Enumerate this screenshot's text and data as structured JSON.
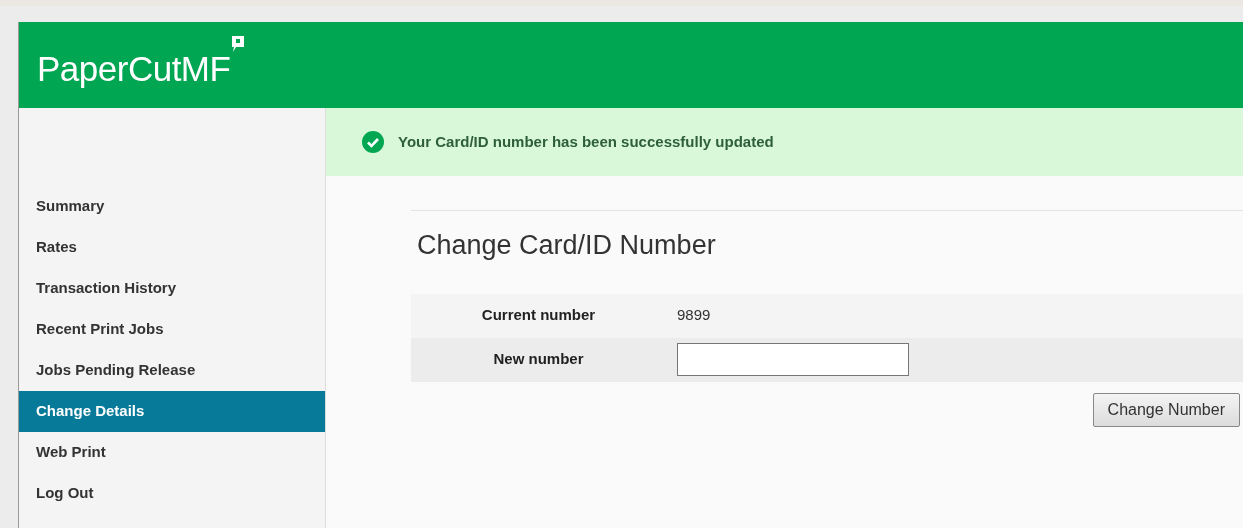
{
  "header": {
    "logo": "PaperCutMF"
  },
  "sidebar": {
    "items": [
      {
        "label": "Summary",
        "selected": false
      },
      {
        "label": "Rates",
        "selected": false
      },
      {
        "label": "Transaction History",
        "selected": false
      },
      {
        "label": "Recent Print Jobs",
        "selected": false
      },
      {
        "label": "Jobs Pending Release",
        "selected": false
      },
      {
        "label": "Change Details",
        "selected": true
      },
      {
        "label": "Web Print",
        "selected": false
      },
      {
        "label": "Log Out",
        "selected": false
      }
    ]
  },
  "message": {
    "text": "Your Card/ID number has been successfully updated"
  },
  "form": {
    "title": "Change Card/ID Number",
    "rows": [
      {
        "kind": "text",
        "label": "Current number",
        "value": "9899"
      },
      {
        "kind": "input",
        "label": "New number"
      }
    ],
    "button": "Change Number"
  }
}
